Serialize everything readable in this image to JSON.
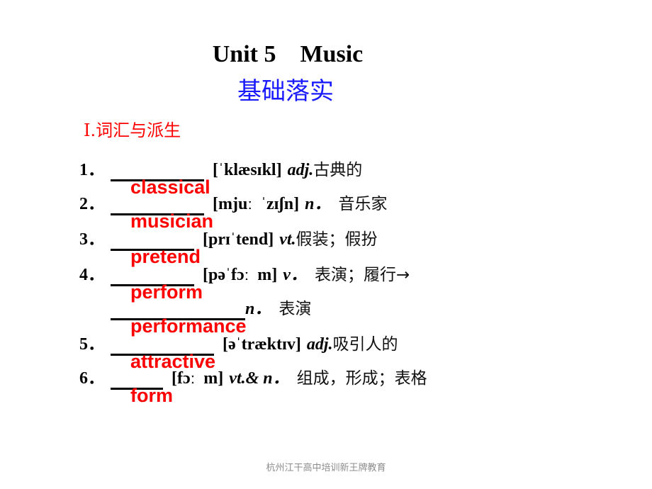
{
  "header": {
    "title": "Unit 5    Music",
    "subtitle": "基础落实"
  },
  "section": {
    "label": "Ⅰ.词汇与派生"
  },
  "vocab": [
    {
      "num": "1．",
      "answer": "classical",
      "phonetic": "[ˈklæsɪkl]",
      "pos": "adj.",
      "meaning": "古典的"
    },
    {
      "num": "2．",
      "answer": "musician",
      "phonetic": "[mjuː  ˈzɪʃn]",
      "pos": "n．",
      "meaning": "音乐家"
    },
    {
      "num": "3．",
      "answer": "pretend",
      "phonetic": "[prɪˈtend]",
      "pos": "vt.",
      "meaning": "假装；假扮"
    },
    {
      "num": "4．",
      "answer": "perform",
      "phonetic": "[pəˈfɔː  m]",
      "pos": "v．",
      "meaning": "表演；履行→"
    },
    {
      "num": "",
      "answer": "performance",
      "phonetic": "",
      "pos": "n．",
      "meaning": "表演"
    },
    {
      "num": "5．",
      "answer": "attractive",
      "phonetic": "[əˈtræktɪv]",
      "pos": "adj.",
      "meaning": "吸引人的"
    },
    {
      "num": "6．",
      "answer": "form",
      "phonetic": "[fɔː  m]",
      "pos": "vt.& n．",
      "meaning": "组成，形成；表格"
    }
  ],
  "footer": {
    "text": "杭州江干高中培训新王牌教育"
  }
}
